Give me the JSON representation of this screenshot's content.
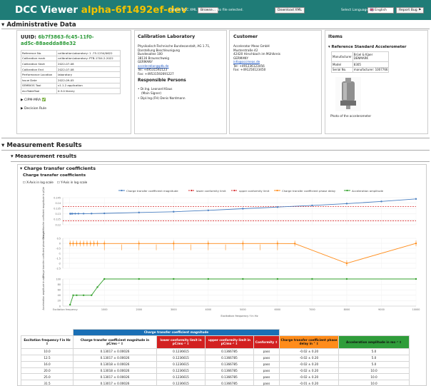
{
  "header": {
    "title": "DCC Viewer",
    "version": "alpha-6f1492ef-dev",
    "upload_label": "Upload DCC XML file:",
    "browse_label": "Browse...",
    "no_file_label": "No file selected.",
    "download_label": "Download XML",
    "language_label": "Select Language:",
    "language_value": "🇬🇧 English",
    "report_label": "Report Bug"
  },
  "admin": {
    "section_title": "Administrative Data",
    "uuid_label": "UUID:",
    "uuid_line1": "6b7f3863-fc45-11f0-",
    "uuid_line2": "ad5c-88aedda88e32",
    "core_rows": [
      [
        "Reference No.",
        "calibrationLaboratory: 1 -75-1254/0622"
      ],
      [
        "Calibration mark",
        "calibrationLaboratory: PTB-1704.2-2022"
      ],
      [
        "Calibration Start",
        "2022-07-08"
      ],
      [
        "Calibration End",
        "2022-07-08"
      ],
      [
        "Performance Location",
        "laboratory"
      ],
      [
        "Issue Date",
        "2022-09-05"
      ],
      [
        "SEMBIOS Tool",
        "v1.1.2 application"
      ],
      [
        "dccTableTool",
        "0.3.0    library"
      ]
    ],
    "cipm_label": "CIPM-MRA ✅",
    "decision_label": "Decision Rule",
    "lab": {
      "title": "Calibration Laboratory",
      "lines": [
        "Physikalisch-Technische Bundesanstalt, AG 1.71,",
        "Darstellung Beschleunigung",
        "Bundesallee 100",
        "38116 Braunschweig",
        "GERMANY"
      ],
      "email": "acceleration@ptb.de",
      "tel": "Tel: +49531592123",
      "fax": "Fax: +49531592691227",
      "persons_title": "Responsible Persons",
      "person1": "Dr.Ing. Leonard Klaus",
      "person1_role": "(Main Signer)",
      "person2": "Dipl.Ing.(FH) Denis Nordmann"
    },
    "customer": {
      "title": "Customer",
      "lines": [
        "Accelerator Meas GmbH",
        "Musterstraße 42",
        "42420 Hirschbach im Mühlkreis",
        "GERMANY"
      ],
      "email": "info@accmeas.de",
      "tel": "Tel: +491236123456",
      "fax": "Fax: +491250123450"
    },
    "items": {
      "title": "Items",
      "sub": "Reference Standard Accelerometer",
      "rows": [
        [
          "Manufacturer",
          "Brüel & Kjaer",
          "DENMARK"
        ],
        [
          "Model",
          "8305",
          ""
        ],
        [
          "Serial No.",
          "manufacturer: 1007766",
          ""
        ]
      ],
      "photo_caption": "Photo of the accelerometer"
    }
  },
  "measurement": {
    "section_title": "Measurement Results",
    "sub_title": "Measurement results",
    "charge_title": "Charge transfer coefficients",
    "charge_subtitle": "Charge transfer coefficients",
    "x_log_label": "X-Axis in log scale",
    "y_log_label": "Y-Axis in log scale"
  },
  "chart_data": {
    "type": "line",
    "xlabel": "Excitation frequency f in Hz",
    "legend_position": "top",
    "grid": true,
    "x_ticks": [
      "Excitation frequency",
      "1000",
      "2000",
      "3000",
      "4000",
      "5000",
      "6000",
      "7000",
      "8000",
      "9000",
      "10000"
    ],
    "series": [
      {
        "name": "Charge transfer coefficient magnitude",
        "color": "#4a7fc1"
      },
      {
        "name": "lower conformity limit",
        "color": "#d62728"
      },
      {
        "name": "upper conformity limit",
        "color": "#d62728"
      },
      {
        "name": "Charge transfer coefficient phase delay",
        "color": "#ff8c1a"
      },
      {
        "name": "Acceleration amplitude",
        "color": "#33a02c"
      }
    ],
    "panels": [
      {
        "ylabel": "Charge transfer coefficient magnitude in pC/m·s⁻²",
        "ylim": [
          0.12,
          0.145
        ],
        "y_ticks": [
          "0.145",
          "0.14",
          "0.135",
          "0.13",
          "0.125",
          "0.12"
        ],
        "x": [
          10,
          20,
          40,
          80,
          160,
          250,
          400,
          630,
          1000,
          2000,
          3000,
          4000,
          5000,
          6000,
          7000,
          8000,
          9000,
          10000
        ],
        "values": [
          0.13017,
          0.13017,
          0.13018,
          0.1302,
          0.13022,
          0.13024,
          0.13027,
          0.1303,
          0.1305,
          0.1313,
          0.132,
          0.1333,
          0.1348,
          0.1363,
          0.1378,
          0.1395,
          0.1415,
          0.1438
        ],
        "lower_limit": 0.1236615,
        "upper_limit": 0.1366785
      },
      {
        "ylabel": "Charge transfer coefficient phase delay in °",
        "ylim": [
          -2.5,
          0.5
        ],
        "y_ticks": [
          "0.5",
          "0",
          "-0.5",
          "-1",
          "-1.5",
          "-2",
          "-2.5"
        ],
        "x": [
          10,
          100,
          200,
          300,
          400,
          500,
          600,
          700,
          800,
          1000,
          2000,
          3000,
          4000,
          5000,
          6000,
          6500,
          8000,
          10000
        ],
        "values": [
          -0.02,
          -0.02,
          -0.02,
          -0.02,
          -0.02,
          -0.02,
          -0.02,
          -0.02,
          -0.02,
          -0.02,
          -0.02,
          -0.02,
          -0.02,
          -0.02,
          -0.02,
          -0.03,
          -2.0,
          -0.01
        ]
      },
      {
        "ylabel": "Acceleration amplitude in m/s²",
        "ylim": [
          0,
          100
        ],
        "y_ticks": [
          "100",
          "80",
          "60",
          "40",
          "20",
          "0"
        ],
        "x": [
          10,
          100,
          200,
          400,
          630,
          800,
          1000,
          2000,
          3000,
          4000,
          5000,
          6000,
          7000,
          8000,
          10000
        ],
        "values": [
          5,
          40,
          40,
          40,
          40,
          70,
          100,
          100,
          100,
          100,
          100,
          100,
          100,
          100,
          100
        ]
      }
    ]
  },
  "table": {
    "group_header": "Charge transfer coefficient magnitude",
    "headers": [
      "Excitation frequency f in Hz ⇕",
      "Charge transfer coefficient magnitude in pC/ms⁻² ⇕",
      "lower conformity limit in pC/ms⁻² ⇕",
      "upper conformity limit in pC/ms⁻² ⇕",
      "Conformity ⇕",
      "Charge transfer coefficient phase delay in ° ⇕",
      "Acceleration amplitude in ms⁻² ⇕"
    ],
    "rows": [
      [
        "10.0",
        "0.13017 ± 0.00026",
        "0.1236615",
        "0.1366785",
        "pass",
        "-0.02 ± 0.20",
        "5.0"
      ],
      [
        "12.5",
        "0.13017 ± 0.00026",
        "0.1236615",
        "0.1366785",
        "pass",
        "-0.02 ± 0.20",
        "5.0"
      ],
      [
        "16.0",
        "0.13018 ± 0.00026",
        "0.1236615",
        "0.1366785",
        "pass",
        "-0.02 ± 0.20",
        "5.0"
      ],
      [
        "20.0",
        "0.13018 ± 0.00026",
        "0.1236615",
        "0.1366785",
        "pass",
        "-0.02 ± 0.20",
        "10.0"
      ],
      [
        "25.0",
        "0.13017 ± 0.00026",
        "0.1236615",
        "0.1366785",
        "pass",
        "-0.02 ± 0.20",
        "10.0"
      ],
      [
        "31.5",
        "0.13017 ± 0.00026",
        "0.1236615",
        "0.1366785",
        "pass",
        "-0.01 ± 0.20",
        "10.0"
      ]
    ]
  }
}
